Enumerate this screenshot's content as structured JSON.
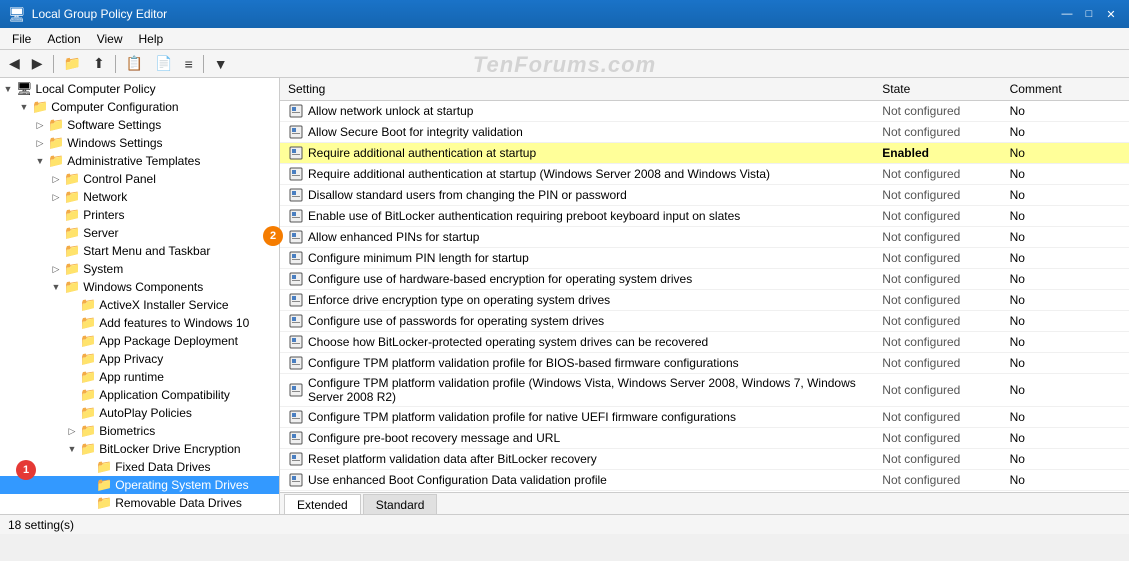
{
  "window": {
    "title": "Local Group Policy Editor",
    "icon": "🖥"
  },
  "titlebar": {
    "minimize": "—",
    "maximize": "□",
    "close": "✕"
  },
  "menubar": {
    "items": [
      "File",
      "Action",
      "View",
      "Help"
    ]
  },
  "watermark": "TenForums.com",
  "status": {
    "count": "18 setting(s)"
  },
  "tabs": [
    {
      "label": "Extended",
      "active": true
    },
    {
      "label": "Standard",
      "active": false
    }
  ],
  "table": {
    "headers": [
      "Setting",
      "State",
      "Comment"
    ],
    "rows": [
      {
        "setting": "Allow network unlock at startup",
        "state": "Not configured",
        "comment": "No",
        "highlighted": false
      },
      {
        "setting": "Allow Secure Boot for integrity validation",
        "state": "Not configured",
        "comment": "No",
        "highlighted": false
      },
      {
        "setting": "Require additional authentication at startup",
        "state": "Enabled",
        "comment": "No",
        "highlighted": true
      },
      {
        "setting": "Require additional authentication at startup (Windows Server 2008 and Windows Vista)",
        "state": "Not configured",
        "comment": "No",
        "highlighted": false
      },
      {
        "setting": "Disallow standard users from changing the PIN or password",
        "state": "Not configured",
        "comment": "No",
        "highlighted": false
      },
      {
        "setting": "Enable use of BitLocker authentication requiring preboot keyboard input on slates",
        "state": "Not configured",
        "comment": "No",
        "highlighted": false
      },
      {
        "setting": "Allow enhanced PINs for startup",
        "state": "Not configured",
        "comment": "No",
        "highlighted": false
      },
      {
        "setting": "Configure minimum PIN length for startup",
        "state": "Not configured",
        "comment": "No",
        "highlighted": false
      },
      {
        "setting": "Configure use of hardware-based encryption for operating system drives",
        "state": "Not configured",
        "comment": "No",
        "highlighted": false
      },
      {
        "setting": "Enforce drive encryption type on operating system drives",
        "state": "Not configured",
        "comment": "No",
        "highlighted": false
      },
      {
        "setting": "Configure use of passwords for operating system drives",
        "state": "Not configured",
        "comment": "No",
        "highlighted": false
      },
      {
        "setting": "Choose how BitLocker-protected operating system drives can be recovered",
        "state": "Not configured",
        "comment": "No",
        "highlighted": false
      },
      {
        "setting": "Configure TPM platform validation profile for BIOS-based firmware configurations",
        "state": "Not configured",
        "comment": "No",
        "highlighted": false
      },
      {
        "setting": "Configure TPM platform validation profile (Windows Vista, Windows Server 2008, Windows 7, Windows Server 2008 R2)",
        "state": "Not configured",
        "comment": "No",
        "highlighted": false
      },
      {
        "setting": "Configure TPM platform validation profile for native UEFI firmware configurations",
        "state": "Not configured",
        "comment": "No",
        "highlighted": false
      },
      {
        "setting": "Configure pre-boot recovery message and URL",
        "state": "Not configured",
        "comment": "No",
        "highlighted": false
      },
      {
        "setting": "Reset platform validation data after BitLocker recovery",
        "state": "Not configured",
        "comment": "No",
        "highlighted": false
      },
      {
        "setting": "Use enhanced Boot Configuration Data validation profile",
        "state": "Not configured",
        "comment": "No",
        "highlighted": false
      }
    ]
  },
  "tree": {
    "root": {
      "label": "Local Computer Policy",
      "children": [
        {
          "label": "Computer Configuration",
          "expanded": true,
          "children": [
            {
              "label": "Software Settings",
              "expanded": false
            },
            {
              "label": "Windows Settings",
              "expanded": false
            },
            {
              "label": "Administrative Templates",
              "expanded": true,
              "children": [
                {
                  "label": "Control Panel",
                  "expanded": false
                },
                {
                  "label": "Network",
                  "expanded": false
                },
                {
                  "label": "Printers",
                  "expanded": false
                },
                {
                  "label": "Server",
                  "expanded": false
                },
                {
                  "label": "Start Menu and Taskbar",
                  "expanded": false
                },
                {
                  "label": "System",
                  "expanded": false
                },
                {
                  "label": "Windows Components",
                  "expanded": true,
                  "children": [
                    {
                      "label": "ActiveX Installer Service"
                    },
                    {
                      "label": "Add features to Windows 10"
                    },
                    {
                      "label": "App Package Deployment"
                    },
                    {
                      "label": "App Privacy"
                    },
                    {
                      "label": "App runtime"
                    },
                    {
                      "label": "Application Compatibility"
                    },
                    {
                      "label": "AutoPlay Policies"
                    },
                    {
                      "label": "Biometrics"
                    },
                    {
                      "label": "BitLocker Drive Encryption",
                      "expanded": true,
                      "children": [
                        {
                          "label": "Fixed Data Drives"
                        },
                        {
                          "label": "Operating System Drives",
                          "selected": true
                        },
                        {
                          "label": "Removable Data Drives"
                        }
                      ]
                    }
                  ]
                }
              ]
            }
          ]
        }
      ]
    }
  },
  "badges": [
    {
      "id": 1,
      "color": "red",
      "text": "1"
    },
    {
      "id": 2,
      "color": "orange",
      "text": "2"
    }
  ]
}
